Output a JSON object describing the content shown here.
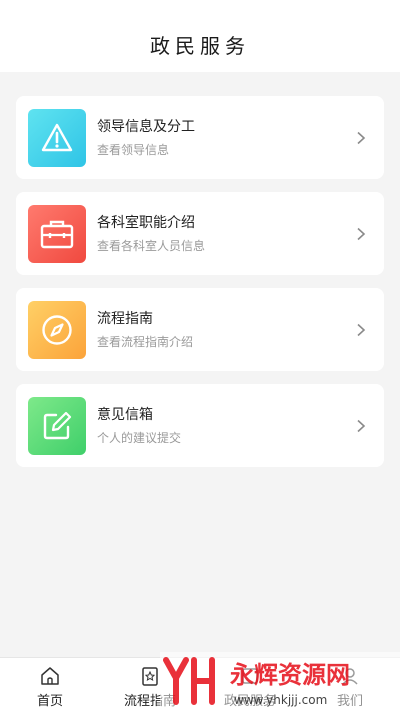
{
  "header": {
    "title": "政民服务"
  },
  "cards": [
    {
      "title": "领导信息及分工",
      "subtitle": "查看领导信息",
      "icon": "warning-triangle-icon",
      "color": "#2fc4e6"
    },
    {
      "title": "各科室职能介绍",
      "subtitle": "查看各科室人员信息",
      "icon": "briefcase-icon",
      "color": "#f0493f"
    },
    {
      "title": "流程指南",
      "subtitle": "查看流程指南介绍",
      "icon": "compass-icon",
      "color": "#fba33a"
    },
    {
      "title": "意见信箱",
      "subtitle": "个人的建议提交",
      "icon": "edit-icon",
      "color": "#3fcf6a"
    }
  ],
  "tabs": [
    {
      "label": "首页",
      "icon": "home-icon"
    },
    {
      "label": "流程指南",
      "icon": "guide-icon"
    },
    {
      "label": "政民服务",
      "icon": "service-icon"
    },
    {
      "label": "我们",
      "icon": "user-icon"
    }
  ],
  "watermark": {
    "brand": "永辉资源网",
    "url": "www.yhkjjj.com"
  }
}
